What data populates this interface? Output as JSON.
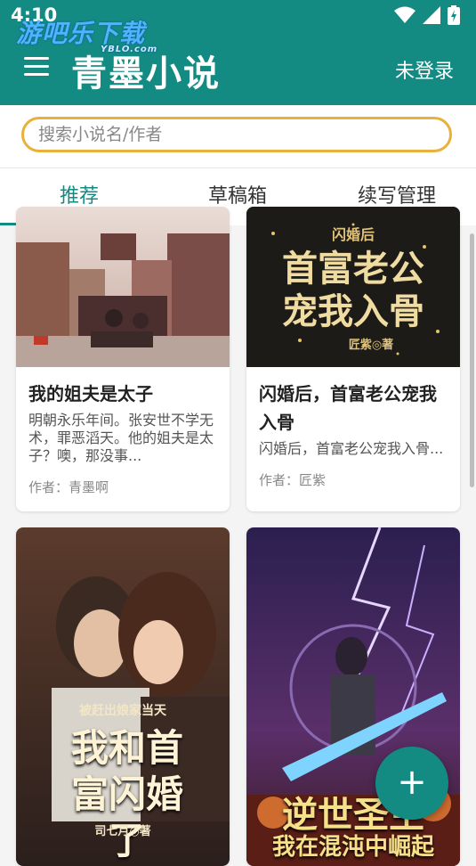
{
  "status_bar": {
    "time": "4:10"
  },
  "watermark": {
    "text": "游吧乐下载",
    "sub": "YBLO.com"
  },
  "app_bar": {
    "title": "青墨小说",
    "login_label": "未登录"
  },
  "search": {
    "placeholder": "搜索小说名/作者",
    "value": ""
  },
  "tabs": [
    {
      "label": "推荐",
      "active": true
    },
    {
      "label": "草稿箱",
      "active": false
    },
    {
      "label": "续写管理",
      "active": false
    }
  ],
  "books": [
    {
      "title": "我的姐夫是太子",
      "description": "明朝永乐年间。张安世不学无术，罪恶滔天。他的姐夫是太子？噢，那没事...",
      "author": "作者：青墨啊"
    },
    {
      "title": "闪婚后，首富老公宠我入骨",
      "description": "闪婚后，首富老公宠我入骨...",
      "author": "作者：匠紫",
      "cover_text_top": "闪婚后",
      "cover_text_main": "首富老公宠我入骨",
      "cover_author": "匠紫◎著"
    },
    {
      "title": "被赶出娘家当天，我和首富闪婚了",
      "cover_text_top": "被赶出娘家当天",
      "cover_text_main": "我和首富闪婚了",
      "cover_author": "司七月◎著"
    },
    {
      "title": "逆世圣主，我在混沌中崛起",
      "cover_text_main": "逆世圣主",
      "cover_text_sub": "我在混沌中崛起"
    }
  ],
  "fab": {
    "icon": "plus-icon",
    "label": "+"
  },
  "colors": {
    "primary": "#138b83",
    "search_border": "#e7b13b"
  }
}
